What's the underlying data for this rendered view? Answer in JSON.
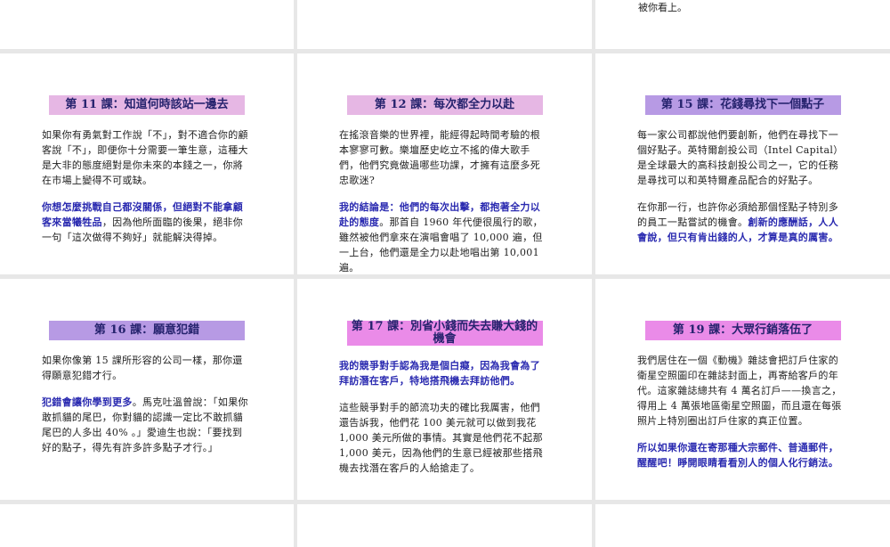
{
  "colors": {
    "title_pink": "#e6b7e4",
    "title_lavender": "#b79ae4",
    "title_magenta": "#ea8be8",
    "highlight_text": "#2a2ab0",
    "body_text": "#222222"
  },
  "top_row": {
    "right_fragment": "被你看上。"
  },
  "cards": [
    {
      "title": "第 11 課：知道何時該站一邊去",
      "paras": [
        {
          "hl": "",
          "text": "如果你有勇氣對工作說「不」，對不適合你的顧客說「不」，即便你十分需要一筆生意，這種大是大非的態度絕對是你未來的本錢之一，你將在市場上變得不可或缺。"
        },
        {
          "hl": "你想怎麼挑戰自己都沒關係，但絕對不能拿顧客來當犧牲品",
          "text": "，因為他所面臨的後果，絕非你一句「這次做得不夠好」就能解決得掉。"
        }
      ]
    },
    {
      "title": "第 12 課：每次都全力以赴",
      "paras": [
        {
          "hl": "",
          "text": "在搖滾音樂的世界裡，能經得起時間考驗的根本寥寥可數。樂壇歷史屹立不搖的偉大歌手們，他們究竟做過哪些功課，才擁有這麼多死忠歌迷?"
        },
        {
          "hl": "我的結論是：他們的每次出擊，都抱著全力以赴的態度",
          "text": "。那首自 1960 年代便很風行的歌，雖然被他們拿來在演唱會唱了 10,000 遍，但一上台，他們還是全力以赴地唱出第 10,001 遍。"
        }
      ]
    },
    {
      "title": "第 15 課：花錢尋找下一個點子",
      "paras": [
        {
          "hl": "",
          "text": "每一家公司都說他們要創新，他們在尋找下一個好點子。英特爾創投公司（Intel Capital）是全球最大的高科技創投公司之一，它的任務是尋找可以和英特爾產品配合的好點子。"
        },
        {
          "hl": "",
          "text": "在你那一行，也許你必須給那個怪點子特別多的員工一點嘗試的機會。",
          "hl_after": "創新的應酬話，人人會說，但只有肯出錢的人，才算是真的厲害。"
        }
      ]
    },
    {
      "title": "第 16 課：願意犯錯",
      "paras": [
        {
          "hl": "",
          "text": "如果你像第 15 課所形容的公司一樣，那你還得願意犯錯才行。"
        },
        {
          "hl": "犯錯會讓你學到更多",
          "text": "。馬克吐溫曾說：「如果你敢抓貓的尾巴，你對貓的認識一定比不敢抓貓尾巴的人多出 40% 。」愛迪生也說：「要找到好的點子，得先有許多許多點子才行。」"
        }
      ]
    },
    {
      "title": "第 17 課：別省小錢而失去賺大錢的機會",
      "paras": [
        {
          "hl": "我的競爭對手認為我是個白癡，因為我會為了拜訪潛在客戶，特地搭飛機去拜訪他們。",
          "text": ""
        },
        {
          "hl": "",
          "text": "這些競爭對手的節流功夫的確比我厲害，他們還告訴我，他們花 100 美元就可以做到我花 1,000 美元所做的事情。其實是他們花不起那 1,000 美元，因為他們的生意已經被那些搭飛機去找潛在客戶的人給搶走了。"
        }
      ]
    },
    {
      "title": "第 19 課：大眾行銷落伍了",
      "paras": [
        {
          "hl": "",
          "text": "我們居住在一個《動機》雜誌會把訂戶住家的衛星空照圖印在雜誌封面上，再寄給客戶的年代。這家雜誌總共有 4 萬名訂戶——換言之，得用上 4 萬張地區衛星空照圖，而且還在每張照片上特別圈出訂戶住家的真正位置。"
        },
        {
          "hl": "所以如果你還在寄那種大宗郵件、普通郵件，醒醒吧！睜開眼睛看看別人的個人化行銷法。",
          "text": ""
        }
      ]
    }
  ]
}
